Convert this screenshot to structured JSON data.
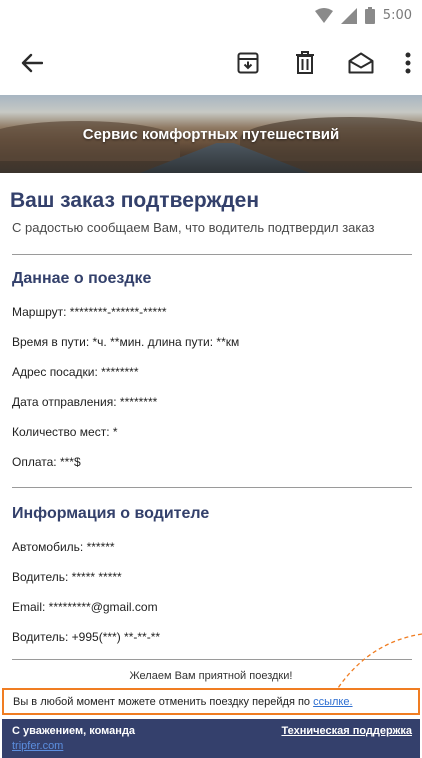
{
  "status_bar": {
    "time": "5:00",
    "icons": [
      "wifi-icon",
      "signal-icon",
      "battery-icon"
    ]
  },
  "app_bar": {
    "icons": [
      "back-arrow-icon",
      "archive-icon",
      "trash-icon",
      "mail-icon",
      "more-vert-icon"
    ]
  },
  "banner": {
    "title": "Сервис комфортных путешествий"
  },
  "headline": "Ваш заказ подтвержден",
  "subhead": "С радостью сообщаем Вам, что водитель подтвердил заказ",
  "trip": {
    "title": "Даннае о поездке",
    "fields": [
      "Маршрут: ********-******-*****",
      "Время в пути: *ч. **мин. длина пути: **км",
      "Адрес посадки: ********",
      "Дата отправления: ********",
      "Количество мест: *",
      "Оплата: ***$"
    ]
  },
  "driver": {
    "title": "Информация о водителе",
    "fields": [
      "Автомобиль: ******",
      "Водитель: ***** *****",
      "Email: *********@gmail.com",
      "Водитель: +995(***) **-**-**"
    ]
  },
  "wish": "Желаем Вам приятной поездки!",
  "cancel": {
    "text": "Вы в любой момент можете отменить поездку перейдя по ",
    "link": "ссылке."
  },
  "footer": {
    "regards": "С уважением, команда",
    "site": "tripfer.com",
    "support": "Техническая поддержка"
  },
  "colors": {
    "accent": "#33406b",
    "highlight_border": "#f07d22",
    "link": "#2f6fd1",
    "footer_bg": "#34406c"
  }
}
